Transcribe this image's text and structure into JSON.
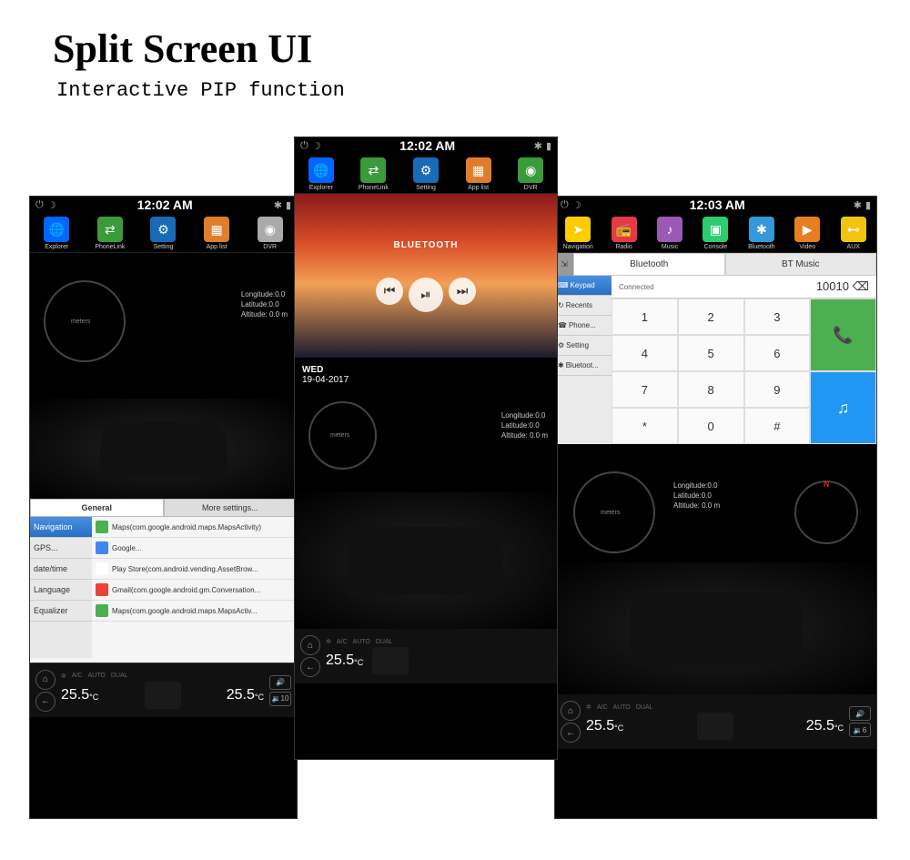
{
  "header": {
    "title": "Split Screen UI",
    "subtitle": "Interactive PIP function"
  },
  "screen1": {
    "time": "12:02 AM",
    "dock": [
      {
        "label": "Explorer",
        "color": "#0066ff",
        "glyph": "🌐"
      },
      {
        "label": "PhoneLink",
        "color": "#3a9b3a",
        "glyph": "⇄"
      },
      {
        "label": "Setting",
        "color": "#1a6bb5",
        "glyph": "⚙"
      },
      {
        "label": "App list",
        "color": "#e07d2a",
        "glyph": "▦"
      },
      {
        "label": "DVR",
        "color": "#aaa",
        "glyph": "◉"
      }
    ],
    "gauge_label": "meters",
    "gps": {
      "lon": "Longitude:0.0",
      "lat": "Latitude:0.0",
      "alt": "Altitude: 0.0 m"
    },
    "settings_tabs": [
      "General",
      "More settings..."
    ],
    "settings_sidebar": [
      "Navigation",
      "GPS...",
      "date/time",
      "Language",
      "Equalizer"
    ],
    "settings_list": [
      {
        "color": "#4caf50",
        "text": "Maps(com.google.android.maps.MapsActivity)"
      },
      {
        "color": "#4285f4",
        "text": "Google..."
      },
      {
        "color": "#fff",
        "text": "Play Store(com.android.vending.AssetBrow..."
      },
      {
        "color": "#ea4335",
        "text": "Gmail(com.google.android.gm.Conversation..."
      },
      {
        "color": "#4caf50",
        "text": "Maps(com.google.android.maps.MapsActiv..."
      }
    ],
    "ac_labels": [
      "A/C",
      "AUTO",
      "DUAL"
    ],
    "temp_left": "25.5",
    "temp_right": "25.5",
    "temp_unit": "°C",
    "vol": "10"
  },
  "screen2": {
    "time": "12:02 AM",
    "dock": [
      {
        "label": "Explorer",
        "color": "#0066ff",
        "glyph": "🌐"
      },
      {
        "label": "PhoneLink",
        "color": "#3a9b3a",
        "glyph": "⇄"
      },
      {
        "label": "Setting",
        "color": "#1a6bb5",
        "glyph": "⚙"
      },
      {
        "label": "App list",
        "color": "#e07d2a",
        "glyph": "▦"
      },
      {
        "label": "DVR",
        "color": "#3a9b3a",
        "glyph": "◉"
      }
    ],
    "video_title": "BLUETOOTH",
    "day": "WED",
    "date": "19-04-2017",
    "gauge_label": "meters",
    "gps": {
      "lon": "Longitude:0.0",
      "lat": "Latitude:0.0",
      "alt": "Altitude: 0.0 m"
    },
    "ac_labels": [
      "A/C",
      "AUTO",
      "DUAL"
    ],
    "temp_left": "25.5",
    "temp_unit": "°C"
  },
  "screen3": {
    "time": "12:03 AM",
    "dock": [
      {
        "label": "Navigation",
        "color": "#ffcc00",
        "glyph": "➤"
      },
      {
        "label": "Radio",
        "color": "#e63946",
        "glyph": "📻"
      },
      {
        "label": "Music",
        "color": "#9b59b6",
        "glyph": "♪"
      },
      {
        "label": "Console",
        "color": "#2ecc71",
        "glyph": "▣"
      },
      {
        "label": "Bluetooth",
        "color": "#3498db",
        "glyph": "✱"
      },
      {
        "label": "Video",
        "color": "#e67e22",
        "glyph": "▶"
      },
      {
        "label": "AUX",
        "color": "#f1c40f",
        "glyph": "⊷"
      }
    ],
    "bt_tabs": [
      "Bluetooth",
      "BT Music"
    ],
    "bt_sidebar": [
      {
        "icon": "⌨",
        "label": "Keypad"
      },
      {
        "icon": "↻",
        "label": "Recents"
      },
      {
        "icon": "☎",
        "label": "Phone..."
      },
      {
        "icon": "⚙",
        "label": "Setting"
      },
      {
        "icon": "✱",
        "label": "Bluetoot..."
      }
    ],
    "connected": "Connected",
    "number": "10010",
    "backspace": "⌫",
    "keys": [
      "1",
      "2",
      "3",
      "4",
      "5",
      "6",
      "7",
      "8",
      "9",
      "*",
      "0",
      "#"
    ],
    "gauge_label": "meters",
    "compass_n": "N",
    "gps": {
      "lon": "Longitude:0.0",
      "lat": "Latitude:0.0",
      "alt": "Altitude: 0.0 m"
    },
    "ac_labels": [
      "A/C",
      "AUTO",
      "DUAL"
    ],
    "temp_left": "25.5",
    "temp_right": "25.5",
    "temp_unit": "°C",
    "vol": "6"
  }
}
